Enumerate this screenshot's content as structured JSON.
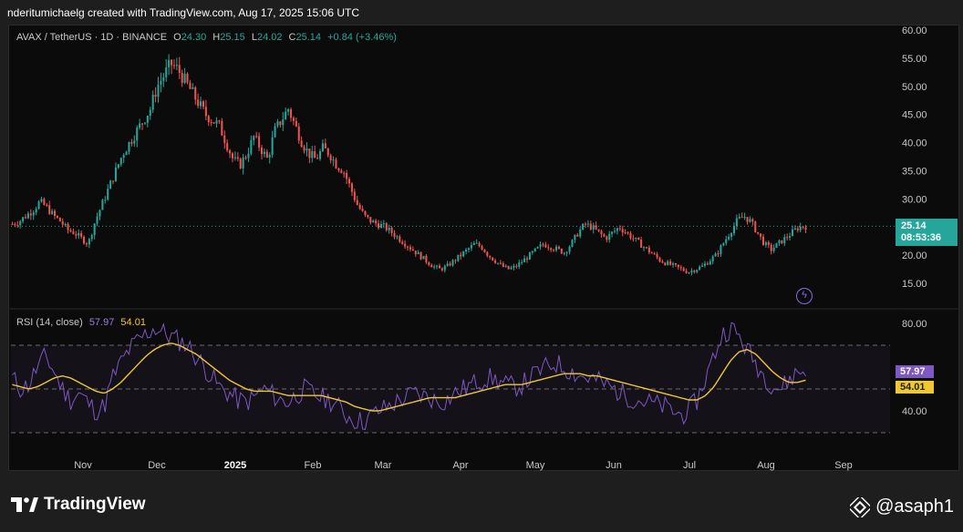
{
  "header": {
    "attribution": "nderitumichaelg created with TradingView.com, Aug 17, 2025 15:06 UTC"
  },
  "legend": {
    "symbol": "AVAX / TetherUS · 1D · BINANCE",
    "o_label": "O",
    "o_value": "24.30",
    "h_label": "H",
    "h_value": "25.15",
    "l_label": "L",
    "l_value": "24.02",
    "c_label": "C",
    "c_value": "25.14",
    "change": "+0.84 (+3.46%)"
  },
  "rsi_legend": {
    "label": "RSI (14, close)",
    "rsi_value": "57.97",
    "ma_value": "54.01"
  },
  "price_axis": {
    "ticks": [
      "60.00",
      "55.00",
      "50.00",
      "45.00",
      "40.00",
      "35.00",
      "30.00",
      "25.00",
      "20.00",
      "15.00"
    ]
  },
  "rsi_axis": {
    "ticks": [
      "80.00",
      "40.00"
    ]
  },
  "price_tag": {
    "price": "25.14",
    "countdown": "08:53:36"
  },
  "rsi_tags": {
    "rsi": "57.97",
    "ma": "54.01"
  },
  "time_axis": {
    "labels": [
      "Nov",
      "Dec",
      "2025",
      "Feb",
      "Mar",
      "Apr",
      "May",
      "Jun",
      "Jul",
      "Aug",
      "Sep"
    ]
  },
  "footer": {
    "brand": "TradingView",
    "user": "@asaph1"
  },
  "colors": {
    "up": "#26a69a",
    "down": "#ef5350",
    "rsi": "#7e57c2",
    "rsi_ma": "#f0c830",
    "background": "#0b0b0b"
  },
  "chart_data": {
    "type": "candlestick",
    "symbol": "AVAX / TetherUS",
    "interval": "1D",
    "ylim": [
      12,
      61
    ],
    "close_path": [
      25.5,
      26,
      27,
      28,
      29.5,
      28.5,
      27,
      26,
      24.5,
      24,
      23,
      22,
      26,
      29,
      32,
      35,
      38,
      40,
      42,
      44,
      46,
      50,
      52,
      54,
      53,
      51,
      49,
      47,
      45,
      44,
      43,
      40,
      37,
      36,
      38,
      41,
      39,
      37,
      42,
      44,
      46,
      43,
      40,
      38,
      37,
      39,
      38,
      36,
      35,
      32,
      29,
      27,
      26,
      25.5,
      25,
      24,
      23,
      22,
      21,
      20,
      19,
      18,
      17.5,
      18,
      19,
      20,
      21,
      22,
      21.5,
      20,
      19,
      18,
      17.5,
      18,
      19,
      20,
      21,
      22,
      21.5,
      21,
      20.5,
      22,
      24,
      25.5,
      25,
      24,
      23,
      24,
      25,
      24,
      23,
      22,
      21,
      20,
      19,
      18.5,
      18,
      17.5,
      17,
      17.5,
      18,
      19,
      20,
      22,
      24,
      26,
      27,
      26,
      24,
      22,
      21,
      22,
      23,
      24,
      25,
      25.14
    ],
    "rsi_path": [
      55,
      50,
      52,
      60,
      65,
      58,
      50,
      45,
      48,
      44,
      40,
      42,
      55,
      62,
      68,
      72,
      75,
      78,
      76,
      74,
      72,
      70,
      65,
      60,
      55,
      50,
      48,
      45,
      44,
      46,
      50,
      48,
      45,
      44,
      47,
      50,
      48,
      46,
      45,
      42,
      38,
      36,
      35,
      38,
      40,
      42,
      44,
      46,
      48,
      47,
      46,
      44,
      45,
      48,
      50,
      52,
      54,
      55,
      54,
      52,
      51,
      52,
      55,
      58,
      60,
      62,
      60,
      58,
      56,
      55,
      54,
      52,
      50,
      48,
      46,
      45,
      44,
      43,
      42,
      40,
      38,
      40,
      45,
      55,
      65,
      75,
      78,
      74,
      68,
      62,
      56,
      52,
      50,
      54,
      58,
      57.97
    ],
    "rsi_ma_path": [
      52,
      51,
      50,
      51,
      53,
      55,
      56,
      55,
      53,
      51,
      49,
      48,
      50,
      53,
      57,
      61,
      65,
      68,
      70,
      71,
      70,
      68,
      66,
      63,
      60,
      57,
      54,
      52,
      50,
      49,
      49,
      49,
      48,
      47,
      47,
      47,
      47,
      47,
      46,
      45,
      44,
      42,
      41,
      40,
      40,
      41,
      42,
      43,
      44,
      45,
      46,
      46,
      46,
      46,
      47,
      48,
      49,
      50,
      51,
      52,
      52,
      52,
      53,
      54,
      55,
      56,
      57,
      57,
      57,
      56,
      56,
      55,
      54,
      53,
      52,
      51,
      50,
      49,
      48,
      47,
      46,
      45,
      45,
      47,
      51,
      57,
      63,
      67,
      68,
      66,
      62,
      58,
      55,
      53,
      53,
      54.01
    ],
    "rsi_levels": [
      70,
      50,
      30
    ]
  }
}
